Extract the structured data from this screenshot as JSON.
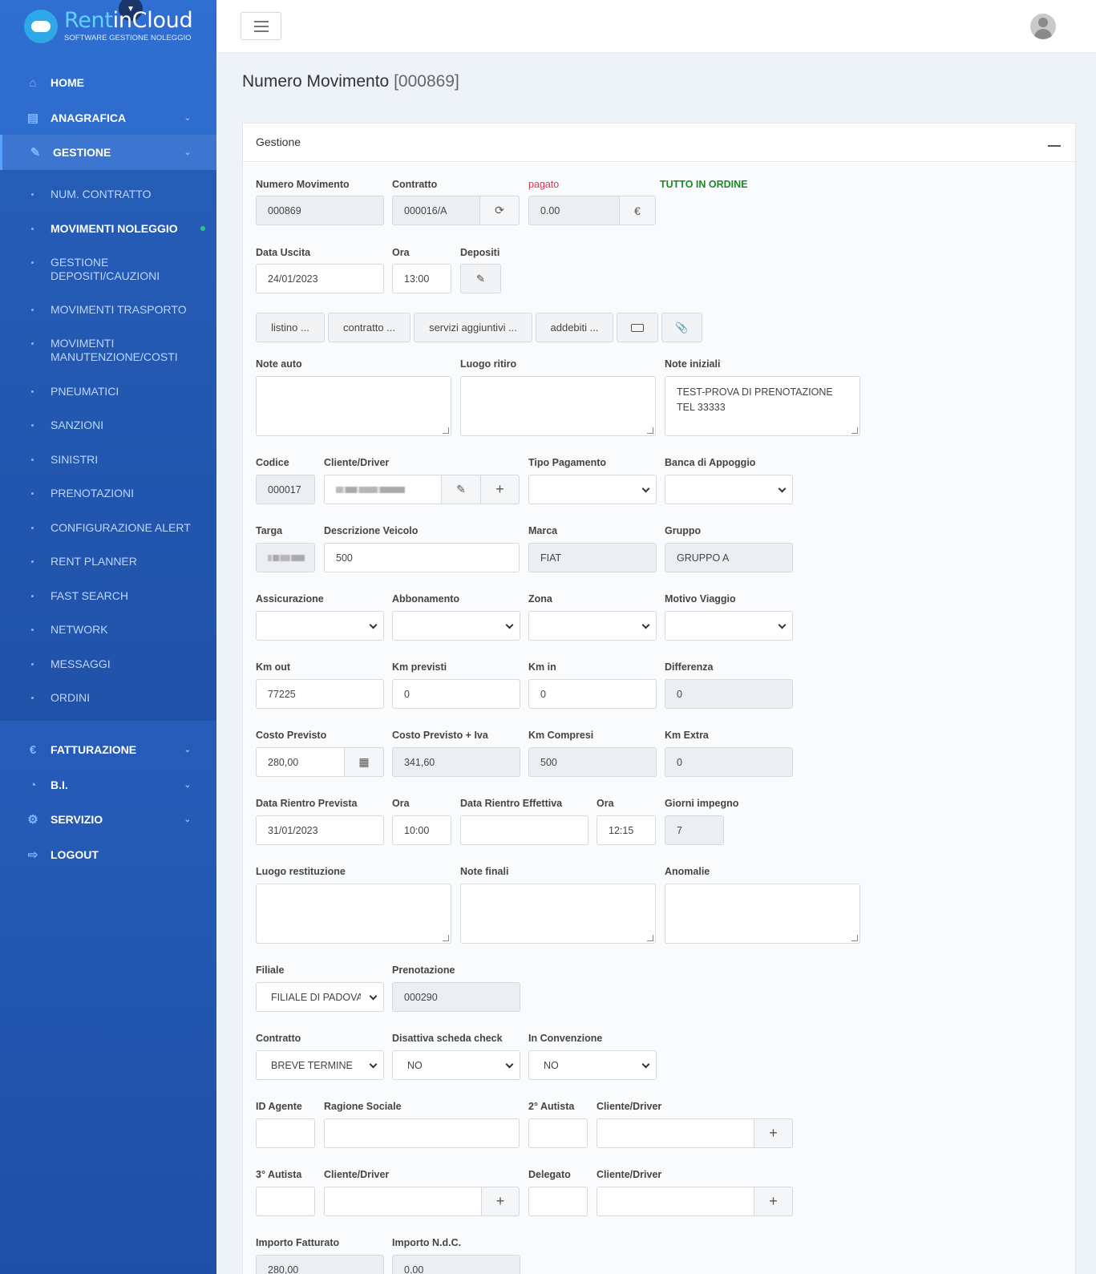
{
  "brand": {
    "name_part1": "Rent",
    "name_part2": "inCloud",
    "tagline": "SOFTWARE GESTIONE NOLEGGIO"
  },
  "nav": {
    "home": "HOME",
    "anagrafica": "ANAGRAFICA",
    "gestione": "GESTIONE",
    "fatturazione": "FATTURAZIONE",
    "bi": "B.I.",
    "servizio": "SERVIZIO",
    "logout": "LOGOUT"
  },
  "submenu": [
    "NUM. CONTRATTO",
    "MOVIMENTI NOLEGGIO",
    "GESTIONE DEPOSITI/CAUZIONI",
    "MOVIMENTI TRASPORTO",
    "MOVIMENTI MANUTENZIONE/COSTI",
    "PNEUMATICI",
    "SANZIONI",
    "SINISTRI",
    "PRENOTAZIONI",
    "CONFIGURAZIONE ALERT",
    "RENT PLANNER",
    "FAST SEARCH",
    "NETWORK",
    "MESSAGGI",
    "ORDINI"
  ],
  "page": {
    "title": "Numero Movimento",
    "number": "[000869]"
  },
  "card": {
    "title": "Gestione"
  },
  "form": {
    "numero_movimento": {
      "label": "Numero Movimento",
      "value": "000869"
    },
    "contratto": {
      "label": "Contratto",
      "value": "000016/A"
    },
    "pagato": {
      "label": "pagato",
      "value": "0.00",
      "currency": "€"
    },
    "status": "TUTTO IN ORDINE",
    "data_uscita": {
      "label": "Data Uscita",
      "value": "24/01/2023"
    },
    "ora_uscita": {
      "label": "Ora",
      "value": "13:00"
    },
    "depositi": {
      "label": "Depositi"
    },
    "buttons": {
      "listino": "listino ...",
      "contratto": "contratto ...",
      "servizi": "servizi aggiuntivi ...",
      "addebiti": "addebiti ..."
    },
    "note_auto": {
      "label": "Note auto",
      "value": ""
    },
    "luogo_ritiro": {
      "label": "Luogo ritiro",
      "value": ""
    },
    "note_iniziali": {
      "label": "Note iniziali",
      "value": "TEST-PROVA DI PRENOTAZIONE\nTEL 33333"
    },
    "codice": {
      "label": "Codice",
      "value": "000017"
    },
    "cliente_driver": {
      "label": "Cliente/Driver"
    },
    "tipo_pagamento": {
      "label": "Tipo Pagamento",
      "value": ""
    },
    "banca_appoggio": {
      "label": "Banca di Appoggio",
      "value": ""
    },
    "targa": {
      "label": "Targa"
    },
    "descrizione_veicolo": {
      "label": "Descrizione Veicolo",
      "value": "500"
    },
    "marca": {
      "label": "Marca",
      "value": "FIAT"
    },
    "gruppo": {
      "label": "Gruppo",
      "value": "GRUPPO A"
    },
    "assicurazione": {
      "label": "Assicurazione",
      "value": ""
    },
    "abbonamento": {
      "label": "Abbonamento",
      "value": ""
    },
    "zona": {
      "label": "Zona",
      "value": ""
    },
    "motivo_viaggio": {
      "label": "Motivo Viaggio",
      "value": ""
    },
    "km_out": {
      "label": "Km out",
      "value": "77225"
    },
    "km_previsti": {
      "label": "Km previsti",
      "value": "0"
    },
    "km_in": {
      "label": "Km in",
      "value": "0"
    },
    "differenza": {
      "label": "Differenza",
      "value": "0"
    },
    "costo_previsto": {
      "label": "Costo Previsto",
      "value": "280,00"
    },
    "costo_previsto_iva": {
      "label": "Costo Previsto + Iva",
      "value": "341,60"
    },
    "km_compresi": {
      "label": "Km Compresi",
      "value": "500"
    },
    "km_extra": {
      "label": "Km Extra",
      "value": "0"
    },
    "data_rientro_prevista": {
      "label": "Data Rientro Prevista",
      "value": "31/01/2023"
    },
    "ora_rientro_prevista": {
      "label": "Ora",
      "value": "10:00"
    },
    "data_rientro_effettiva": {
      "label": "Data Rientro Effettiva",
      "value": ""
    },
    "ora_rientro_effettiva": {
      "label": "Ora",
      "value": "12:15"
    },
    "giorni_impegno": {
      "label": "Giorni impegno",
      "value": "7"
    },
    "luogo_restituzione": {
      "label": "Luogo restituzione",
      "value": ""
    },
    "note_finali": {
      "label": "Note finali",
      "value": ""
    },
    "anomalie": {
      "label": "Anomalie",
      "value": ""
    },
    "filiale": {
      "label": "Filiale",
      "value": "FILIALE DI PADOVA"
    },
    "prenotazione": {
      "label": "Prenotazione",
      "value": "000290"
    },
    "contratto_tipo": {
      "label": "Contratto",
      "value": "BREVE TERMINE"
    },
    "disattiva_check": {
      "label": "Disattiva scheda check",
      "value": "NO"
    },
    "in_convenzione": {
      "label": "In Convenzione",
      "value": "NO"
    },
    "id_agente": {
      "label": "ID Agente",
      "value": ""
    },
    "ragione_sociale": {
      "label": "Ragione Sociale",
      "value": ""
    },
    "autista2": {
      "label": "2° Autista",
      "value": ""
    },
    "cliente_driver2": {
      "label": "Cliente/Driver",
      "value": ""
    },
    "autista3": {
      "label": "3° Autista",
      "value": ""
    },
    "cliente_driver3": {
      "label": "Cliente/Driver",
      "value": ""
    },
    "delegato": {
      "label": "Delegato",
      "value": ""
    },
    "cliente_driver4": {
      "label": "Cliente/Driver",
      "value": ""
    },
    "importo_fatturato": {
      "label": "Importo Fatturato",
      "value": "280,00"
    },
    "importo_ndc": {
      "label": "Importo N.d.C.",
      "value": "0,00"
    }
  },
  "icons": [
    "home-icon",
    "database-icon",
    "edit-icon",
    "euro-icon",
    "chart-icon",
    "gear-icon",
    "logout-icon",
    "refresh-icon",
    "pencil-icon",
    "plus-icon",
    "calculator-icon",
    "money-icon",
    "paperclip-icon",
    "chevron-down-icon"
  ]
}
